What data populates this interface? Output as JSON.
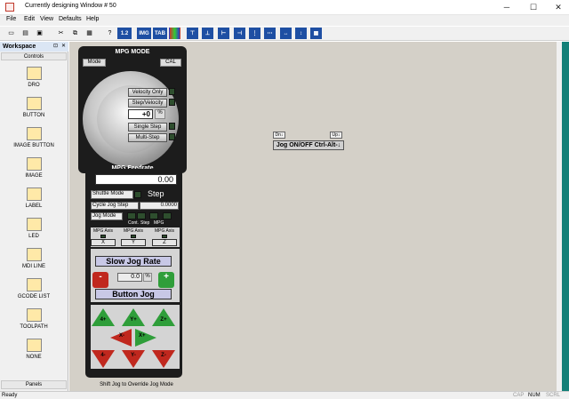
{
  "window": {
    "title": "Currently designing Window # 50",
    "btn_min": "─",
    "btn_max": "☐",
    "btn_close": "✕"
  },
  "menu": [
    "File",
    "Edit",
    "View",
    "Defaults",
    "Help"
  ],
  "toolbar": {
    "icons": [
      "new-icon",
      "open-icon",
      "save-icon",
      "cut-icon",
      "copy-icon",
      "paste-icon",
      "help-icon",
      "tab-order-icon",
      "image-icon",
      "tab-icon",
      "colors-icon",
      "align-top-icon",
      "align-bottom-icon",
      "align-left-icon",
      "align-right-icon",
      "center-v-icon",
      "center-h-icon",
      "space-h-icon",
      "space-v-icon",
      "grid-icon"
    ],
    "label_12": "1.2",
    "label_tab": "TAB",
    "label_img": "IMG"
  },
  "workspace": {
    "title": "Workspace",
    "pin": "⊡",
    "close": "✕",
    "section": "Controls",
    "footer": "Panels",
    "tools": [
      {
        "label": "DRO",
        "icon": "dro-icon"
      },
      {
        "label": "BUTTON",
        "icon": "button-icon"
      },
      {
        "label": "IMAGE BUTTON",
        "icon": "image-button-icon"
      },
      {
        "label": "IMAGE",
        "icon": "image-icon"
      },
      {
        "label": "LABEL",
        "icon": "label-icon"
      },
      {
        "label": "LED",
        "icon": "led-icon"
      },
      {
        "label": "MDI LINE",
        "icon": "mdi-line-icon"
      },
      {
        "label": "GCODE LIST",
        "icon": "gcode-list-icon"
      },
      {
        "label": "TOOLPATH",
        "icon": "toolpath-icon"
      },
      {
        "label": "NONE",
        "icon": "none-icon"
      }
    ]
  },
  "mpg": {
    "title": "MPG MODE",
    "mode": "Mode",
    "cal": "CAL",
    "velocity_only": "Velocity Only",
    "step_velocity": "Step/Velocity",
    "counter": "+0",
    "counter_unit": "%",
    "single_step": "Single Step",
    "multi_step": "Multi-Step",
    "feedrate_label": "MPG Feedrate",
    "feedrate_value": "0.00"
  },
  "pendant": {
    "shuttle_mode": "Shuttle Mode",
    "step_label": "Step",
    "cycle_jog_step": "Cycle Jog Step",
    "cycle_value": "0.0000",
    "jog_mode": "Jog Mode",
    "cont": "Cont.",
    "step": "Step",
    "mpg": "MPG",
    "axis_label": "MPG Axis",
    "axes": [
      "X",
      "Y",
      "Z"
    ],
    "slow_jog": "Slow Jog Rate",
    "jog_pct": "0.0",
    "pct": "%",
    "button_jog": "Button Jog",
    "jog_up": [
      "4+",
      "Y+",
      "Z+"
    ],
    "jog_mid": [
      "X-",
      "X+"
    ],
    "jog_down": [
      "4-",
      "Y-",
      "Z-"
    ],
    "minus": "-",
    "plus": "+",
    "hint": "Shift Jog to Override Jog Mode"
  },
  "jog_widget": {
    "left": "Dn↓",
    "right": "Up↓",
    "main": "Jog ON/OFF Ctrl-Alt-↓"
  },
  "status": {
    "left": "Ready",
    "cap": "CAP",
    "num": "NUM",
    "scrl": "SCRL"
  }
}
